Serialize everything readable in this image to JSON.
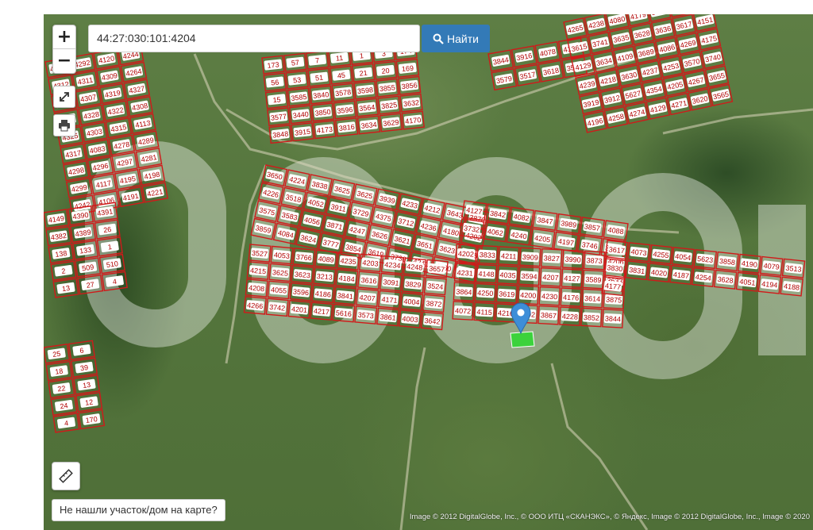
{
  "search": {
    "value": "44:27:030:101:4204",
    "button_label": "Найти",
    "button_icon": "search-icon"
  },
  "zoom": {
    "in_label": "+",
    "out_label": "−"
  },
  "tools": {
    "fullscreen_icon": "expand-icon",
    "print_icon": "printer-icon",
    "ruler_icon": "ruler-icon"
  },
  "not_found_label": "Не нашли участок/дом на карте?",
  "attribution": "Image © 2012 DigitalGlobe, Inc., © ООО ИТЦ «СКАНЭКС», © Яндекс, Image © 2012 DigitalGlobe, Inc., Image © 2020",
  "colors": {
    "parcel_border": "#d01a1a",
    "label_bg": "#ffffff",
    "label_text": "#b00000",
    "selected_parcel": "#3cd23c",
    "marker": "#3e8ed8",
    "button_blue": "#337ab7"
  },
  "selected_parcel": "4204",
  "parcels": [
    "4293",
    "4292",
    "4120",
    "4244",
    "4312",
    "4311",
    "4309",
    "4264",
    "4304",
    "4307",
    "4319",
    "4327",
    "4326",
    "4328",
    "4322",
    "4308",
    "4325",
    "4303",
    "4315",
    "4113",
    "4317",
    "4083",
    "4278",
    "4289",
    "4298",
    "4296",
    "4297",
    "4281",
    "4299",
    "4117",
    "4195",
    "4198",
    "4242",
    "4106",
    "4191",
    "4221",
    "4149",
    "4390",
    "4391",
    "4382",
    "4389",
    "26",
    "138",
    "133",
    "1",
    "2",
    "509",
    "510",
    "13",
    "27",
    "4",
    "25",
    "6",
    "18",
    "39",
    "22",
    "13",
    "24",
    "12",
    "4",
    "170",
    "173",
    "57",
    "7",
    "11",
    "1",
    "3",
    "174",
    "56",
    "53",
    "51",
    "45",
    "21",
    "20",
    "169",
    "15",
    "3585",
    "3840",
    "3578",
    "3598",
    "3855",
    "3856",
    "3577",
    "3440",
    "3850",
    "3596",
    "3564",
    "3825",
    "3632",
    "3848",
    "3915",
    "4173",
    "3816",
    "3634",
    "3629",
    "4170",
    "3844",
    "3916",
    "4078",
    "4121",
    "3579",
    "3517",
    "3618",
    "3568",
    "4265",
    "4238",
    "4080",
    "4179",
    "3836",
    "3591",
    "3576",
    "3615",
    "3741",
    "3635",
    "3628",
    "3636",
    "3617",
    "4151",
    "4129",
    "3634",
    "4109",
    "3689",
    "4086",
    "4269",
    "4175",
    "4239",
    "4218",
    "3630",
    "4237",
    "4253",
    "3570",
    "3740",
    "3919",
    "3912",
    "5627",
    "4354",
    "4205",
    "4267",
    "3655",
    "4196",
    "4258",
    "4274",
    "4129",
    "4271",
    "3620",
    "3565",
    "3650",
    "4224",
    "3838",
    "3625",
    "3625",
    "3939",
    "4233",
    "4212",
    "3643",
    "3870",
    "4226",
    "3518",
    "4052",
    "3911",
    "3729",
    "4375",
    "3712",
    "4236",
    "4180",
    "4202",
    "3575",
    "3583",
    "4056",
    "3871",
    "4247",
    "3626",
    "3621",
    "3651",
    "3623",
    "3888",
    "3859",
    "4084",
    "3624",
    "3777",
    "3854",
    "3619",
    "3730",
    "4241",
    "4060",
    "4220",
    "4127",
    "3842",
    "4082",
    "3847",
    "3989",
    "3857",
    "4088",
    "3732",
    "4062",
    "4240",
    "4205",
    "4197",
    "3746",
    "3590",
    "3527",
    "4053",
    "3766",
    "4089",
    "4235",
    "4203",
    "4234",
    "4248",
    "3657",
    "4215",
    "3625",
    "3623",
    "3213",
    "4184",
    "3616",
    "3091",
    "3829",
    "3524",
    "4208",
    "4055",
    "3596",
    "4186",
    "3841",
    "4207",
    "4171",
    "4004",
    "3872",
    "4266",
    "3742",
    "4201",
    "4217",
    "5616",
    "3573",
    "3861",
    "4003",
    "3642",
    "4202",
    "3833",
    "4211",
    "3909",
    "3827",
    "3990",
    "3873",
    "4206",
    "4231",
    "4148",
    "4035",
    "3594",
    "4207",
    "4127",
    "3589",
    "3633",
    "3864",
    "4250",
    "3619",
    "4200",
    "4230",
    "4176",
    "3614",
    "3875",
    "4072",
    "4115",
    "4216",
    "4192",
    "3867",
    "4228",
    "3852",
    "3844",
    "3617",
    "4073",
    "4255",
    "4054",
    "5623",
    "3858",
    "4190",
    "4079",
    "3513",
    "3830",
    "3831",
    "4020",
    "4187",
    "4254",
    "3628",
    "4051",
    "4194",
    "4188",
    "4177"
  ]
}
